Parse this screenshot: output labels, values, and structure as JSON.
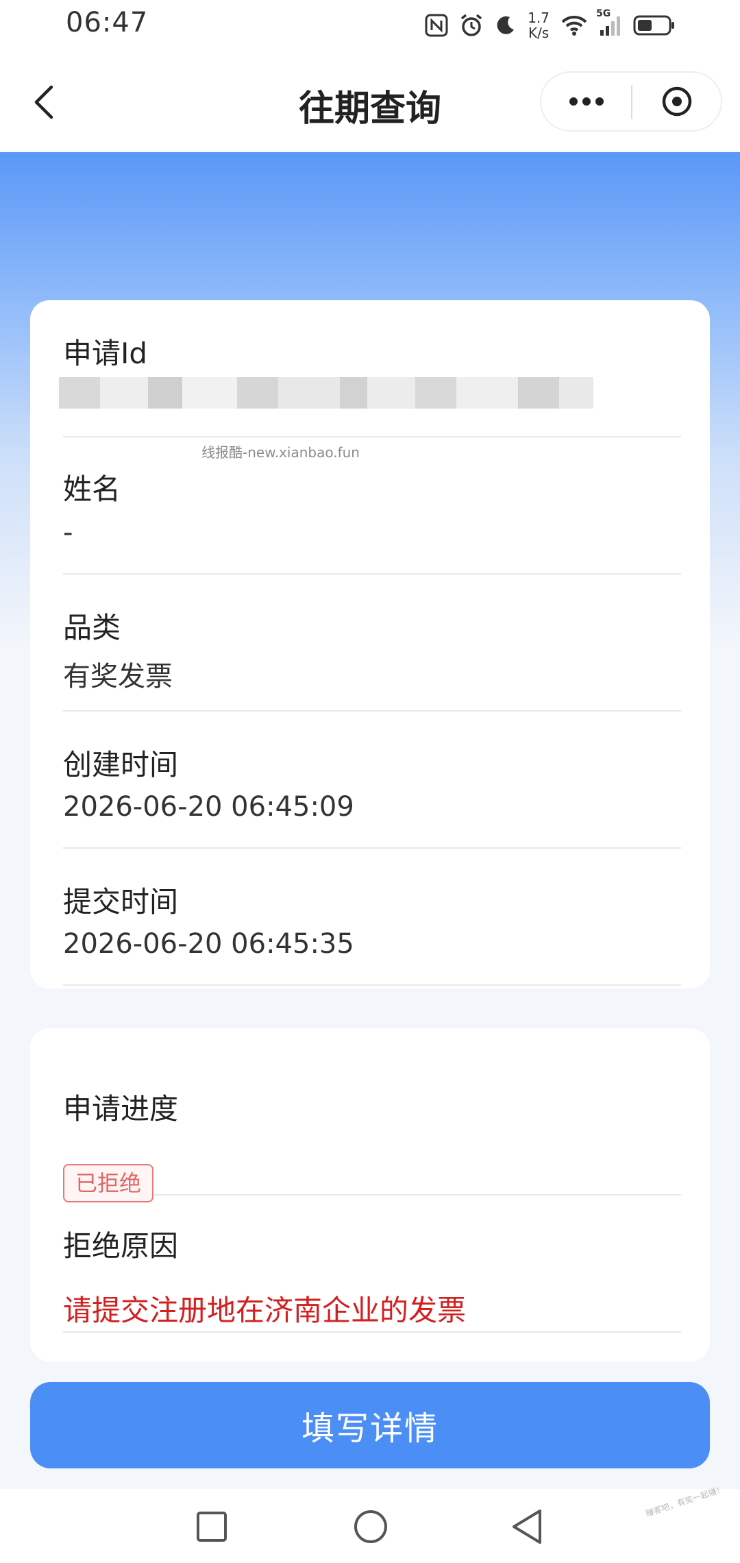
{
  "status_bar": {
    "time": "06:47",
    "net_speed_value": "1.7",
    "net_speed_unit": "K/s",
    "signal_label": "5G",
    "icons": [
      "nfc-icon",
      "alarm-icon",
      "moon-icon",
      "wifi-icon",
      "signal-icon",
      "battery-icon"
    ]
  },
  "nav": {
    "title": "往期查询",
    "icons": [
      "back-chevron-icon",
      "more-dots-icon",
      "close-circle-icon"
    ]
  },
  "info_card": {
    "fields": [
      {
        "label": "申请Id",
        "value": ""
      },
      {
        "label": "姓名",
        "value": "-"
      },
      {
        "label": "品类",
        "value": "有奖发票"
      },
      {
        "label": "创建时间",
        "value": "2026-06-20 06:45:09"
      },
      {
        "label": "提交时间",
        "value": "2026-06-20 06:45:35"
      }
    ]
  },
  "watermark": "线报酷-new.xianbao.fun",
  "progress_card": {
    "progress_label": "申请进度",
    "status_badge": "已拒绝",
    "reason_label": "拒绝原因",
    "reason_text": "请提交注册地在济南企业的发票"
  },
  "action": {
    "fill_details_label": "填写详情"
  },
  "corner_watermark": "赚客吧，有奖一起赚！",
  "colors": {
    "primary": "#4b8ef5",
    "header_gradient_top": "#5a98f7",
    "rejected_red": "#d41f1f",
    "badge_red": "#e06565",
    "background": "#f3f6fb"
  },
  "system_nav": {
    "icons": [
      "recent-apps-icon",
      "home-circle-icon",
      "back-triangle-icon"
    ]
  }
}
